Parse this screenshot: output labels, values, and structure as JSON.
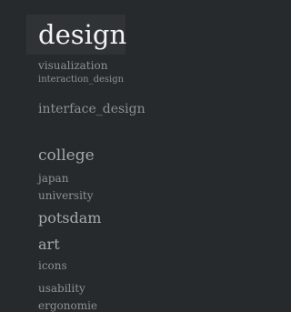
{
  "tag_cloud": {
    "tags": [
      "design",
      "visualization",
      "interaction_design",
      "interface_design",
      "college",
      "japan",
      "university",
      "potsdam",
      "art",
      "icons",
      "usability",
      "ergonomie"
    ],
    "tiny_tags": [
      "·",
      "·",
      "·",
      "·",
      "·",
      "·",
      "·",
      "·",
      "·",
      "·",
      "·",
      "·",
      "·"
    ],
    "active_tag": "design"
  }
}
